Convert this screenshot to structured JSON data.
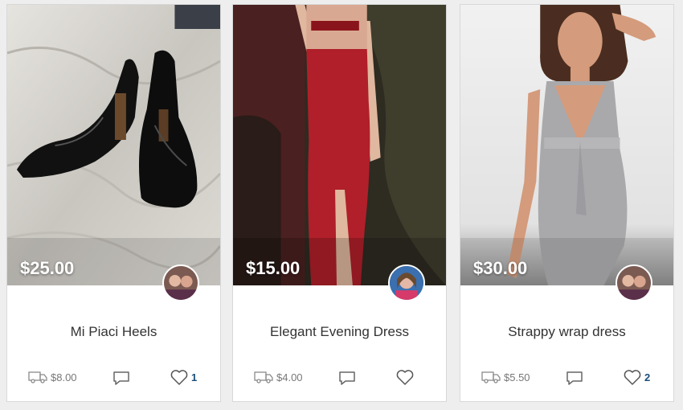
{
  "listings": [
    {
      "price": "$25.00",
      "title": "Mi Piaci Heels",
      "shipping": "$8.00",
      "likes": "1"
    },
    {
      "price": "$15.00",
      "title": "Elegant Evening Dress",
      "shipping": "$4.00",
      "likes": ""
    },
    {
      "price": "$30.00",
      "title": "Strappy wrap dress",
      "shipping": "$5.50",
      "likes": "2"
    }
  ],
  "icons": {
    "shipping": "truck-icon",
    "comment": "comment-bubble-icon",
    "like": "heart-icon"
  },
  "colors": {
    "price_text": "#ffffff",
    "like_count": "#1b4f7a",
    "card_background": "#ffffff"
  }
}
